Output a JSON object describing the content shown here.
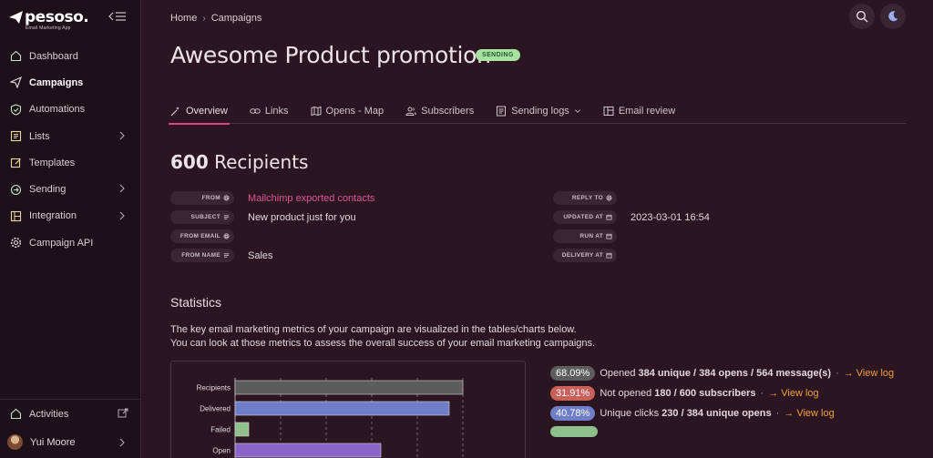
{
  "brand": {
    "name": "pesoso.",
    "tagline": "Email Marketing App"
  },
  "sidebar": {
    "items": [
      {
        "label": "Dashboard",
        "icon": "home-icon",
        "chevron": false,
        "active": false
      },
      {
        "label": "Campaigns",
        "icon": "send-icon",
        "chevron": false,
        "active": true
      },
      {
        "label": "Automations",
        "icon": "shield-icon",
        "chevron": false,
        "active": false
      },
      {
        "label": "Lists",
        "icon": "list-icon",
        "chevron": true,
        "active": false
      },
      {
        "label": "Templates",
        "icon": "edit-icon",
        "chevron": false,
        "active": false
      },
      {
        "label": "Sending",
        "icon": "refresh-icon",
        "chevron": true,
        "active": false
      },
      {
        "label": "Integration",
        "icon": "integration-icon",
        "chevron": true,
        "active": false
      },
      {
        "label": "Campaign API",
        "icon": "gear-icon",
        "chevron": false,
        "active": false
      }
    ],
    "activities": "Activities",
    "user": "Yui Moore"
  },
  "breadcrumb": {
    "home": "Home",
    "sep": "›",
    "current": "Campaigns"
  },
  "page": {
    "title": "Awesome Product promotion",
    "status": "SENDING"
  },
  "tabs": [
    {
      "label": "Overview",
      "icon": "wand-icon",
      "active": true
    },
    {
      "label": "Links",
      "icon": "link-icon",
      "active": false
    },
    {
      "label": "Opens - Map",
      "icon": "map-icon",
      "active": false
    },
    {
      "label": "Subscribers",
      "icon": "users-icon",
      "active": false
    },
    {
      "label": "Sending logs",
      "icon": "log-icon",
      "active": false,
      "dropdown": true
    },
    {
      "label": "Email review",
      "icon": "review-icon",
      "active": false
    }
  ],
  "recipients": {
    "count": "600",
    "label": "Recipients"
  },
  "meta_left": [
    {
      "key": "FROM",
      "icon": "at",
      "value": "Mailchimp exported contacts",
      "link": true
    },
    {
      "key": "SUBJECT",
      "icon": "lines",
      "value": "New product just for you",
      "link": false
    },
    {
      "key": "FROM EMAIL",
      "icon": "at",
      "value": "",
      "link": false
    },
    {
      "key": "FROM NAME",
      "icon": "lines",
      "value": "Sales",
      "link": false
    }
  ],
  "meta_right": [
    {
      "key": "REPLY TO",
      "icon": "at",
      "value": ""
    },
    {
      "key": "UPDATED AT",
      "icon": "calendar",
      "value": "2023-03-01 16:54"
    },
    {
      "key": "RUN AT",
      "icon": "calendar",
      "value": ""
    },
    {
      "key": "DELIVERY AT",
      "icon": "calendar",
      "value": ""
    }
  ],
  "statistics": {
    "title": "Statistics",
    "desc1": "The key email marketing metrics of your campaign are visualized in the tables/charts below.",
    "desc2": "You can look at those metrics to assess the overall success of your email marketing campaigns."
  },
  "chart_data": {
    "type": "bar",
    "orientation": "horizontal",
    "categories": [
      "Recipients",
      "Delivered",
      "Failed",
      "Open"
    ],
    "values": [
      600,
      564,
      36,
      384
    ],
    "xlim": [
      0,
      600
    ],
    "grid": true,
    "colors": [
      "#5c5c5c",
      "#6f7ec8",
      "#8fbf8a",
      "#8a64c8"
    ]
  },
  "metrics": [
    {
      "pct": "68.09%",
      "pre": "Opened ",
      "bold": "384 unique / 384 opens / 564 message(s)",
      "post": "",
      "link": "→ View log",
      "pill_bg": "#5d5d5d",
      "pill_fg": "#ffffff"
    },
    {
      "pct": "31.91%",
      "pre": "Not opened ",
      "bold": "180 / 600 subscribers",
      "post": "",
      "link": "→ View log",
      "pill_bg": "#c9605a",
      "pill_fg": "#ffffff"
    },
    {
      "pct": "40.78%",
      "pre": "Unique clicks ",
      "bold": "230 / 384 unique opens",
      "post": "",
      "link": "→ View log",
      "pill_bg": "#6f7ec8",
      "pill_fg": "#ffffff"
    }
  ],
  "colors": {
    "accent": "#e0447a",
    "link": "#e0579a",
    "view_log": "#f2a33a"
  }
}
